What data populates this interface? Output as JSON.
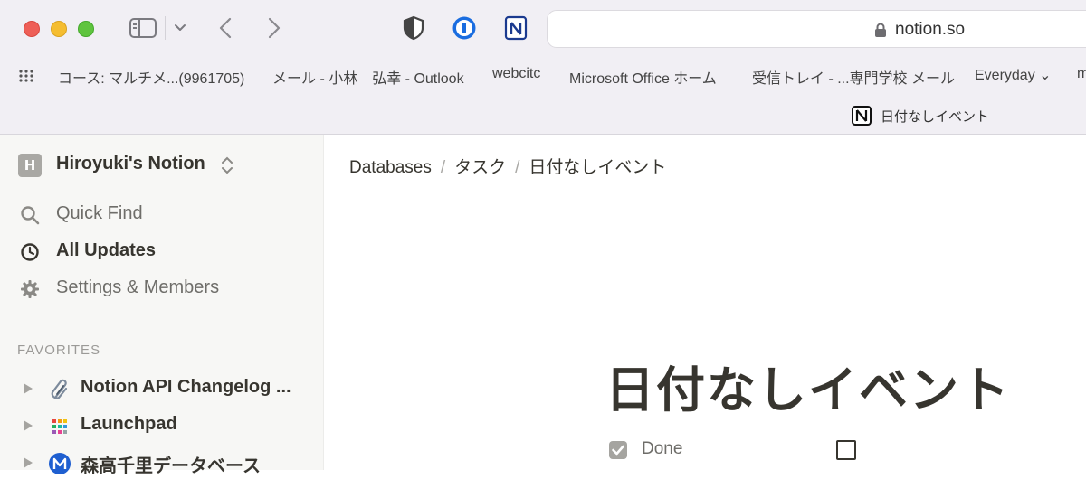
{
  "browser": {
    "address": "notion.so",
    "tab_title": "日付なしイベント",
    "bookmarks": [
      "コース: マルチメ...(9961705)",
      "メール - 小林　弘幸 - Outlook",
      "webcitc",
      "Microsoft Office ホーム",
      "受信トレイ - ...専門学校 メール",
      "Everyday ⌄",
      "m"
    ],
    "icons": [
      "sidebar-toggle-icon",
      "chevron-down-icon",
      "back-arrow-icon",
      "forward-arrow-icon",
      "shield-extension-icon",
      "onepassword-icon",
      "notion-icon",
      "lock-icon",
      "apps-grid-icon"
    ]
  },
  "sidebar": {
    "workspace_initial": "H",
    "workspace_name": "Hiroyuki's Notion",
    "nav": [
      {
        "label": "Quick Find",
        "icon": "search-icon"
      },
      {
        "label": "All Updates",
        "icon": "clock-icon"
      },
      {
        "label": "Settings & Members",
        "icon": "gear-icon"
      }
    ],
    "favorites_header": "FAVORITES",
    "favorites": [
      {
        "label": "Notion API Changelog ...",
        "icon": "paperclip-icon"
      },
      {
        "label": "Launchpad",
        "icon": "launchpad-grid-icon"
      },
      {
        "label": "森高千里データベース",
        "icon": "m-circle-icon"
      }
    ]
  },
  "main": {
    "breadcrumb": [
      "Databases",
      "タスク",
      "日付なしイベント"
    ],
    "breadcrumb_separator": "/",
    "title": "日付なしイベント",
    "properties": [
      {
        "label": "Done",
        "checked": false
      }
    ]
  },
  "colors": {
    "traffic_red": "#ee5f57",
    "traffic_yellow": "#f5bd30",
    "traffic_green": "#5fc43e",
    "sidebar_bg": "#f7f7f5",
    "text": "#37352f"
  }
}
